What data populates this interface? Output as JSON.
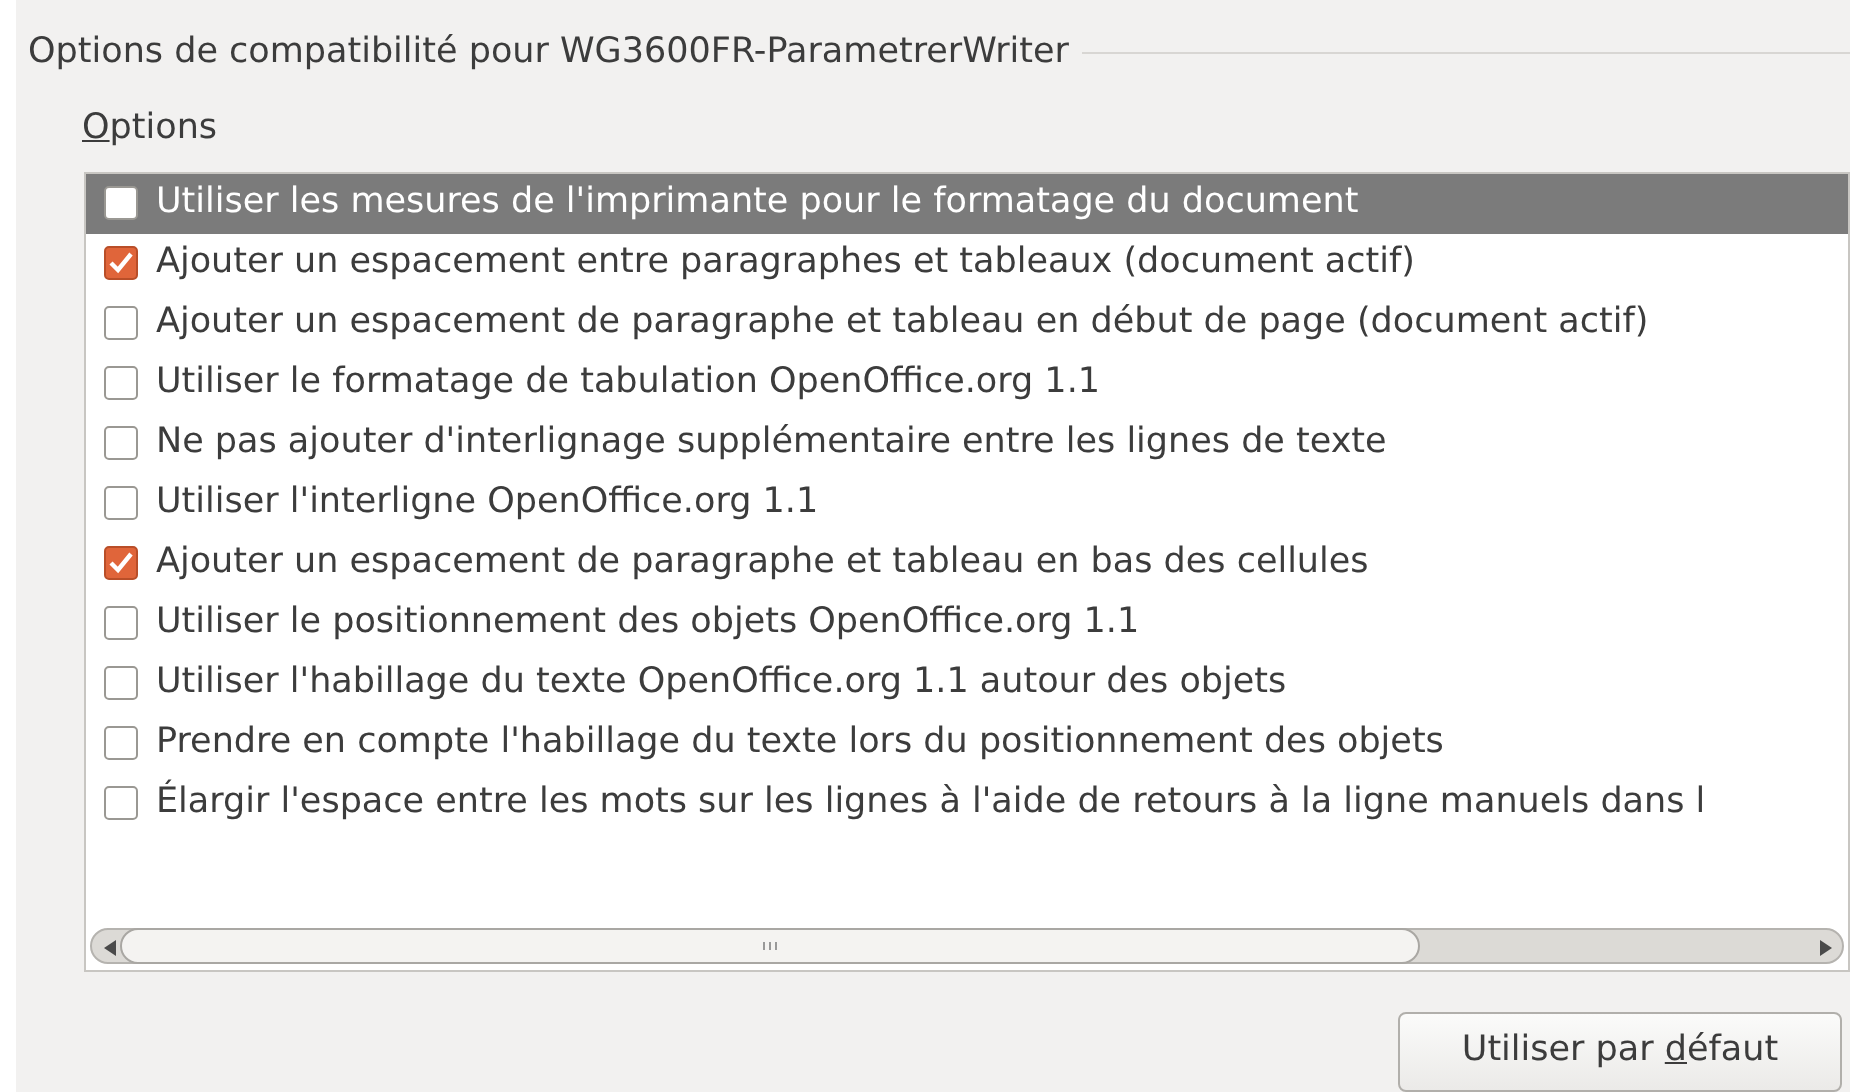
{
  "frame": {
    "title": "Options de compatibilité pour WG3600FR-ParametrerWriter"
  },
  "options_label": {
    "mnemonic": "O",
    "after": "ptions"
  },
  "options": [
    {
      "label": "Utiliser les mesures de l'imprimante pour le formatage du document",
      "checked": false,
      "selected": true
    },
    {
      "label": "Ajouter un espacement entre paragraphes et tableaux (document actif)",
      "checked": true,
      "selected": false
    },
    {
      "label": "Ajouter un espacement de paragraphe et tableau en début de page (document actif)",
      "checked": false,
      "selected": false
    },
    {
      "label": "Utiliser le formatage de tabulation OpenOffice.org 1.1",
      "checked": false,
      "selected": false
    },
    {
      "label": "Ne pas ajouter d'interlignage supplémentaire entre les lignes de texte",
      "checked": false,
      "selected": false
    },
    {
      "label": "Utiliser l'interligne OpenOffice.org 1.1",
      "checked": false,
      "selected": false
    },
    {
      "label": "Ajouter un espacement de paragraphe et tableau en bas des cellules",
      "checked": true,
      "selected": false
    },
    {
      "label": "Utiliser le positionnement des objets OpenOffice.org 1.1",
      "checked": false,
      "selected": false
    },
    {
      "label": "Utiliser l'habillage du texte OpenOffice.org 1.1 autour des objets",
      "checked": false,
      "selected": false
    },
    {
      "label": "Prendre en compte l'habillage du texte lors du positionnement des objets",
      "checked": false,
      "selected": false
    },
    {
      "label": "Élargir l'espace entre les mots sur les lignes à l'aide de retours à la ligne manuels dans l",
      "checked": false,
      "selected": false
    }
  ],
  "default_button": {
    "before": "Utiliser par ",
    "mnemonic": "d",
    "after": "éfaut"
  }
}
